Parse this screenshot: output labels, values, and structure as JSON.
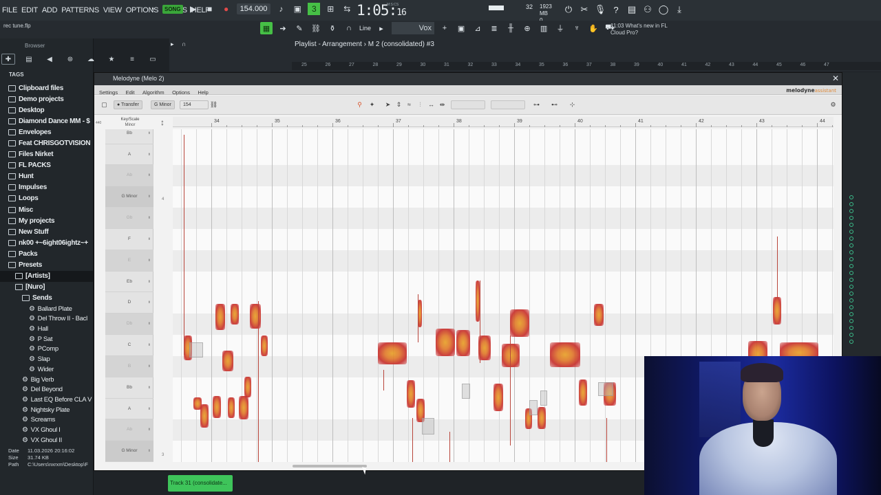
{
  "fl": {
    "menus": [
      "FILE",
      "EDIT",
      "ADD",
      "PATTERNS",
      "VIEW",
      "OPTIONS",
      "TOOLS",
      "HELP"
    ],
    "song_badge": "SONG",
    "tempo": "154.000",
    "clock_main": "1:05:",
    "clock_sub": "16",
    "clock_unit": "M:S:CS",
    "cpu_value": "32",
    "memory": "1923 MB",
    "memory_sub": "0",
    "project_file": "rec tune.flp",
    "line_mode": "Line",
    "channel": "Vox",
    "news_time": "11:03",
    "news_text": "What's new in FL",
    "news_text2": "Cloud Pro?",
    "accent": "#46c046"
  },
  "browser": {
    "title": "Browser",
    "tags_label": "TAGS",
    "items": [
      {
        "label": "Clipboard files",
        "level": 0
      },
      {
        "label": "Demo projects",
        "level": 0
      },
      {
        "label": "Desktop",
        "level": 0
      },
      {
        "label": "Diamond Dance MM - $",
        "level": 0
      },
      {
        "label": "Envelopes",
        "level": 0
      },
      {
        "label": "Feat CHRISGOTVISION",
        "level": 0
      },
      {
        "label": "Files Nirket",
        "level": 0
      },
      {
        "label": "FL PACKS",
        "level": 0
      },
      {
        "label": "Hunt",
        "level": 0
      },
      {
        "label": "Impulses",
        "level": 0
      },
      {
        "label": "Loops",
        "level": 0
      },
      {
        "label": "Misc",
        "level": 0
      },
      {
        "label": "My projects",
        "level": 0
      },
      {
        "label": "New Stuff",
        "level": 0
      },
      {
        "label": "nk00 +~6ight06ightz~+",
        "level": 0
      },
      {
        "label": "Packs",
        "level": 0
      },
      {
        "label": "Presets",
        "level": 0
      },
      {
        "label": "[Artists]",
        "level": 1
      },
      {
        "label": "[Nuro]",
        "level": 1
      },
      {
        "label": "Sends",
        "level": 2
      }
    ],
    "presets": [
      {
        "label": "Ballard Plate",
        "level": 3
      },
      {
        "label": "Del Throw II - Bacl",
        "level": 3
      },
      {
        "label": "Hall",
        "level": 3
      },
      {
        "label": "P Sat",
        "level": 3
      },
      {
        "label": "PComp",
        "level": 3
      },
      {
        "label": "Slap",
        "level": 3
      },
      {
        "label": "Wider",
        "level": 3
      },
      {
        "label": "Big Verb",
        "level": 2
      },
      {
        "label": "Del Beyond",
        "level": 2
      },
      {
        "label": "Last EQ Before CLA V",
        "level": 2
      },
      {
        "label": "Nightsky Plate",
        "level": 2
      },
      {
        "label": "Screams",
        "level": 2
      },
      {
        "label": "VX Ghoul I",
        "level": 2
      },
      {
        "label": "VX Ghoul II",
        "level": 2
      }
    ],
    "info": {
      "date_label": "Date",
      "date": "11.03.2026 20:16:02",
      "size_label": "Size",
      "size": "31.74 KB",
      "path_label": "Path",
      "path": "C:\\Users\\nxrxm\\Desktop\\F"
    }
  },
  "playlist": {
    "title": "Playlist - Arrangement",
    "sep": "›",
    "pattern": "M 2 (consolidated) #3",
    "ruler": [
      "25",
      "26",
      "27",
      "28",
      "29",
      "30",
      "31",
      "32",
      "33",
      "34",
      "35",
      "36",
      "37",
      "38",
      "39",
      "40",
      "41",
      "42",
      "43",
      "44",
      "45",
      "46",
      "47"
    ]
  },
  "melodyne": {
    "window_title": "Melodyne (Melo 2)",
    "menu": [
      "Settings",
      "Edit",
      "Algorithm",
      "Options",
      "Help"
    ],
    "brand": "melodyne",
    "brand_edition": "assistant",
    "transfer_label": "Transfer",
    "key_label": "G Minor",
    "tempo_field": "154",
    "keyscale_title": "Key/Scale",
    "keyscale_sub": "Minor",
    "bars": [
      "34",
      "35",
      "36",
      "37",
      "38",
      "39",
      "40",
      "41",
      "42",
      "43",
      "44"
    ],
    "ruler_left": "440",
    "pitch_rows": [
      "Bb",
      "A",
      "Ab",
      "G Minor",
      "Gb",
      "F",
      "E",
      "Eb",
      "D",
      "Db",
      "C",
      "B",
      "Bb",
      "A",
      "Ab",
      "G Minor"
    ],
    "octave_labels": [
      "4",
      "3"
    ]
  },
  "bottom": {
    "track_button": "Track 31 (consolidate..."
  }
}
